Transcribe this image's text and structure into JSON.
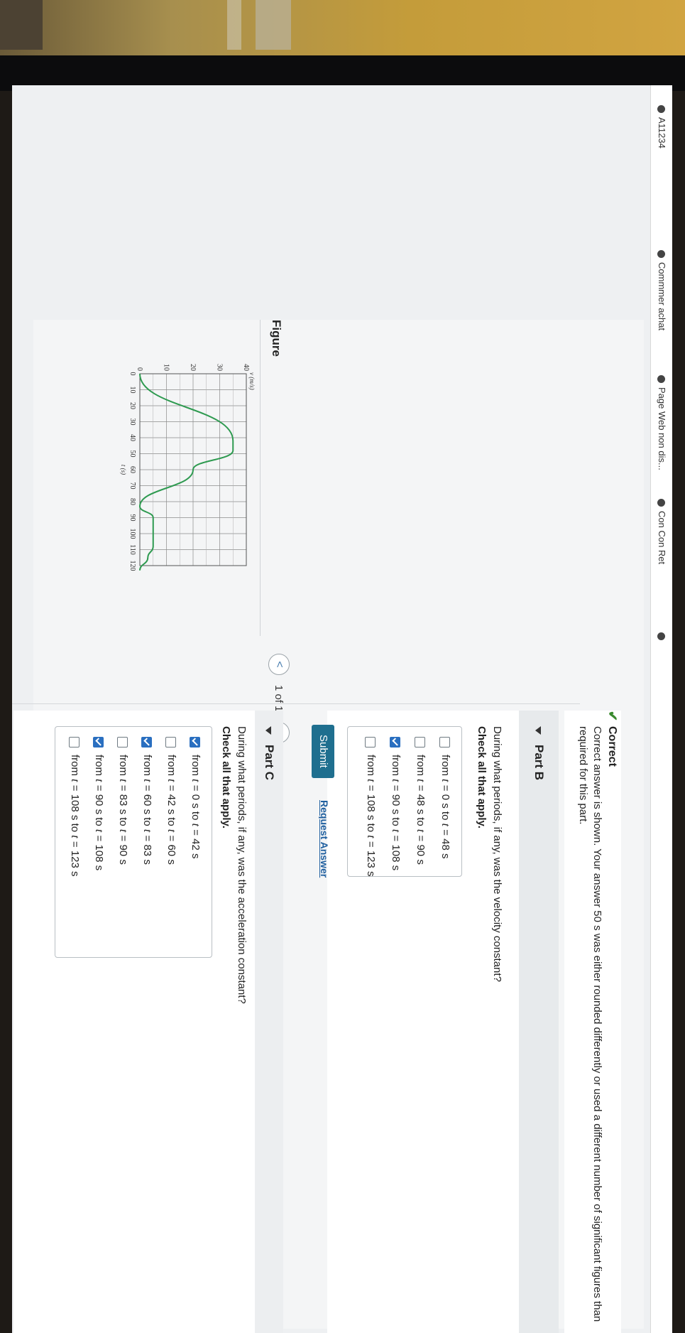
{
  "bookmarks": [
    "A11234",
    "Commmer achat",
    "Page Web non dis...",
    "Con Con Ret",
    ""
  ],
  "figure": {
    "title": "Figure",
    "pager": {
      "prev": "<",
      "label": "1 of 1",
      "next": ">"
    }
  },
  "chart_data": {
    "type": "line",
    "ylabel": "v (m/s)",
    "xlabel": "t (s)",
    "xlim": [
      0,
      120
    ],
    "ylim": [
      0,
      40
    ],
    "x_ticks": [
      "0",
      "10",
      "20",
      "30",
      "40",
      "50",
      "60",
      "70",
      "80",
      "90",
      "100",
      "110",
      "120"
    ],
    "y_ticks": [
      "0",
      "10",
      "20",
      "30",
      "40"
    ],
    "grid": true,
    "series": [
      {
        "x": [
          0,
          42,
          48,
          60,
          83,
          90,
          108,
          115,
          123
        ],
        "y": [
          0,
          35,
          35,
          20,
          0,
          5,
          5,
          3,
          0
        ],
        "color": "#2e9a50"
      }
    ]
  },
  "correct_banner": {
    "title": "Correct",
    "message": "Correct answer is shown. Your answer 50 s was either rounded differently or used a different number of significant figures than required for this part."
  },
  "part_b": {
    "title": "Part B",
    "question": "During what periods, if any, was the velocity constant?",
    "instruction": "Check all that apply.",
    "options": [
      {
        "pre": "from ",
        "t": "t",
        "a": " = 0 s to ",
        "t2": "t",
        "b": " = 48 s",
        "checked": false
      },
      {
        "pre": "from ",
        "t": "t",
        "a": " = 48 s to ",
        "t2": "t",
        "b": " = 90 s",
        "checked": false
      },
      {
        "pre": "from ",
        "t": "t",
        "a": " = 90 s to ",
        "t2": "t",
        "b": " = 108 s",
        "checked": true
      },
      {
        "pre": "from ",
        "t": "t",
        "a": " = 108 s to ",
        "t2": "t",
        "b": " = 123 s",
        "checked": false
      }
    ],
    "submit": "Submit",
    "request": "Request Answer"
  },
  "part_c": {
    "title": "Part C",
    "question": "During what periods, if any, was the acceleration constant?",
    "instruction": "Check all that apply.",
    "options": [
      {
        "pre": "from ",
        "t": "t",
        "a": " = 0 s to ",
        "t2": "t",
        "b": " = 42 s",
        "checked": true
      },
      {
        "pre": "from ",
        "t": "t",
        "a": " = 42 s to ",
        "t2": "t",
        "b": " = 60 s",
        "checked": false
      },
      {
        "pre": "from ",
        "t": "t",
        "a": " = 60 s to ",
        "t2": "t",
        "b": " = 83 s",
        "checked": true
      },
      {
        "pre": "from ",
        "t": "t",
        "a": " = 83 s to ",
        "t2": "t",
        "b": " = 90 s",
        "checked": false
      },
      {
        "pre": "from ",
        "t": "t",
        "a": " = 90 s to ",
        "t2": "t",
        "b": " = 108 s",
        "checked": true
      },
      {
        "pre": "from ",
        "t": "t",
        "a": " = 108 s to ",
        "t2": "t",
        "b": " = 123 s",
        "checked": false
      }
    ]
  },
  "colors": {
    "accent": "#1f6f8f",
    "link": "#1f5f9f",
    "check": "#2a6fc0",
    "correct": "#3a8a2e",
    "curve": "#2e9a50"
  }
}
